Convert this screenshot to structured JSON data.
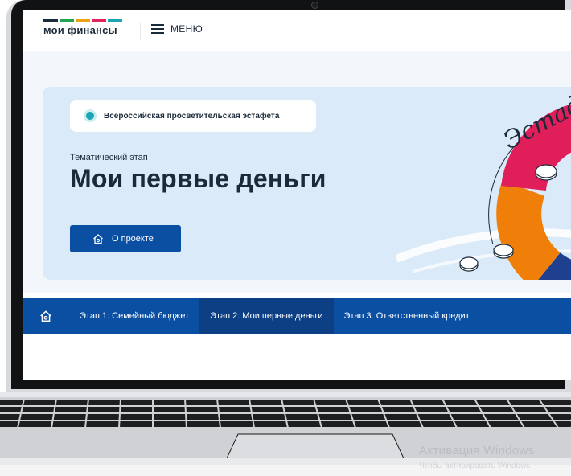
{
  "site": {
    "logo_text": "мои финансы",
    "logo_stripe_colors": [
      "#1b2a3a",
      "#23a455",
      "#e8a317",
      "#e5245e",
      "#1ba6b5"
    ],
    "menu_label": "МЕНЮ"
  },
  "hero": {
    "badge_text": "Всероссийская просветительская эстафета",
    "stage_subtitle": "Тематический этап",
    "stage_title": "Мои первые деньги",
    "about_button_label": "О проекте",
    "relay_word": "Эстафета"
  },
  "stage_nav": {
    "items": [
      {
        "label": "Этап 1: Семейный бюджет",
        "active": false
      },
      {
        "label": "Этап 2: Мои первые деньги",
        "active": true
      },
      {
        "label": "Этап 3: Ответственный кредит",
        "active": false
      }
    ]
  },
  "os": {
    "watermark_title": "Активация Windows",
    "watermark_sub": "Чтобы активировать Windows"
  },
  "colors": {
    "brand_blue": "#0a4fa2",
    "active_stage": "#0d3f85",
    "hero_bg": "#dbeaf8",
    "accent_teal": "#1ba6b5",
    "ring_pink": "#e01e5a",
    "ring_orange": "#f07f0a"
  }
}
